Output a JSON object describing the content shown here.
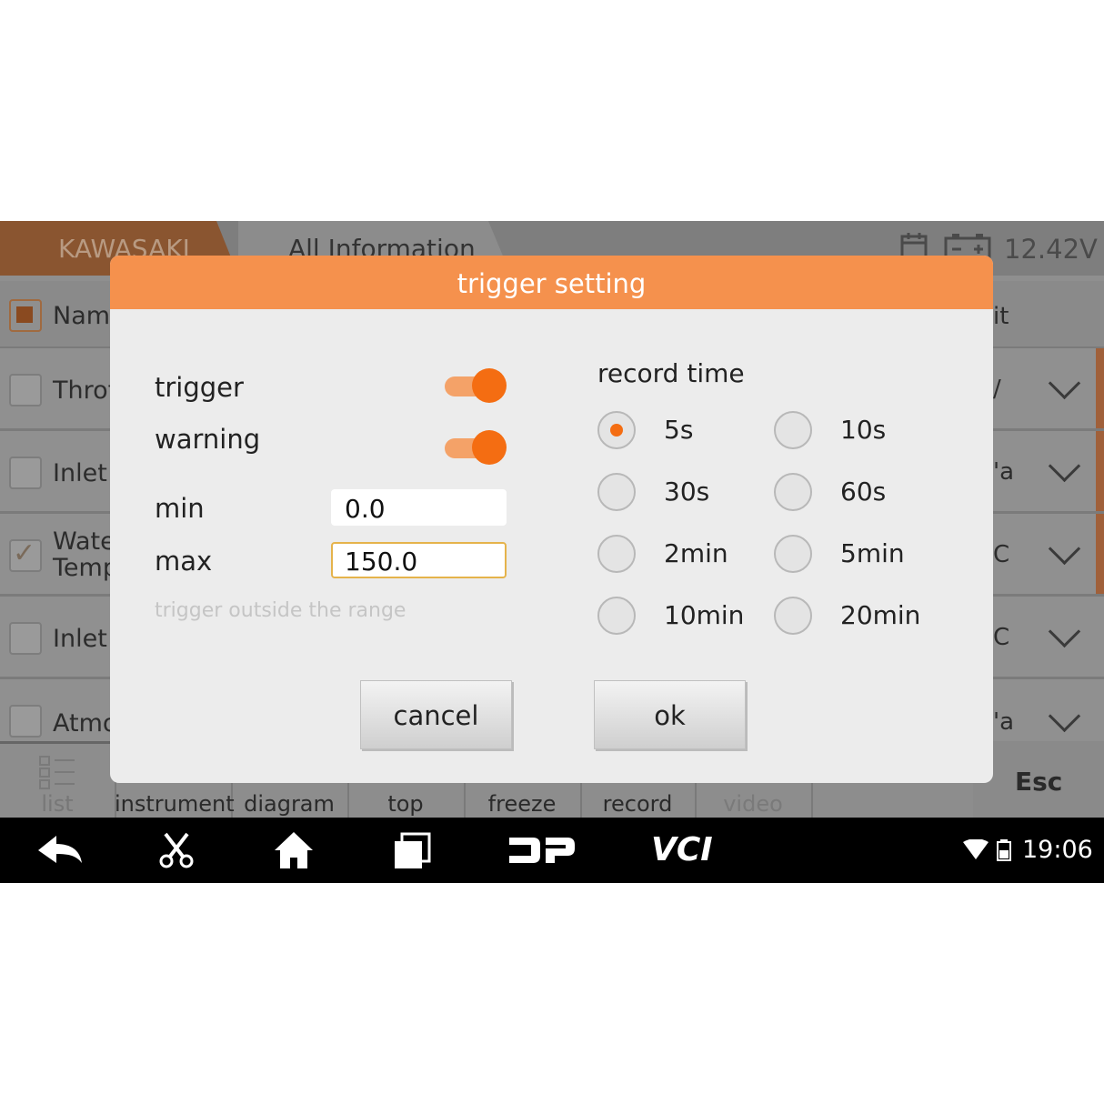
{
  "app": {
    "brand": "KAWASAKI",
    "tab": "All Information",
    "voltage": "12.42V"
  },
  "list": {
    "header_name": "Name",
    "header_right": "it",
    "rows": [
      {
        "name": "Throt",
        "value": "/"
      },
      {
        "name": "Inlet /",
        "value": "'a"
      },
      {
        "name": "Wate\nTemp",
        "value": "C"
      },
      {
        "name": "Inlet /",
        "value": "C"
      },
      {
        "name": "Atmo",
        "value": "'a"
      }
    ]
  },
  "toolbar": {
    "items": [
      "list",
      "instrument",
      "diagram",
      "top",
      "freeze",
      "record",
      "video"
    ],
    "esc": "Esc"
  },
  "navbar": {
    "time": "19:06",
    "dp_label": "DP",
    "vci_label": "VCI"
  },
  "dialog": {
    "title": "trigger setting",
    "trigger_label": "trigger",
    "trigger_on": true,
    "warning_label": "warning",
    "warning_on": true,
    "min_label": "min",
    "min_value": "0.0",
    "max_label": "max",
    "max_value": "150.0",
    "hint": "trigger outside the range",
    "record_time_label": "record time",
    "record_options": [
      "5s",
      "10s",
      "30s",
      "60s",
      "2min",
      "5min",
      "10min",
      "20min"
    ],
    "record_selected": "5s",
    "cancel": "cancel",
    "ok": "ok"
  },
  "colors": {
    "accent": "#f46d12",
    "title_bar": "#f5914d"
  }
}
